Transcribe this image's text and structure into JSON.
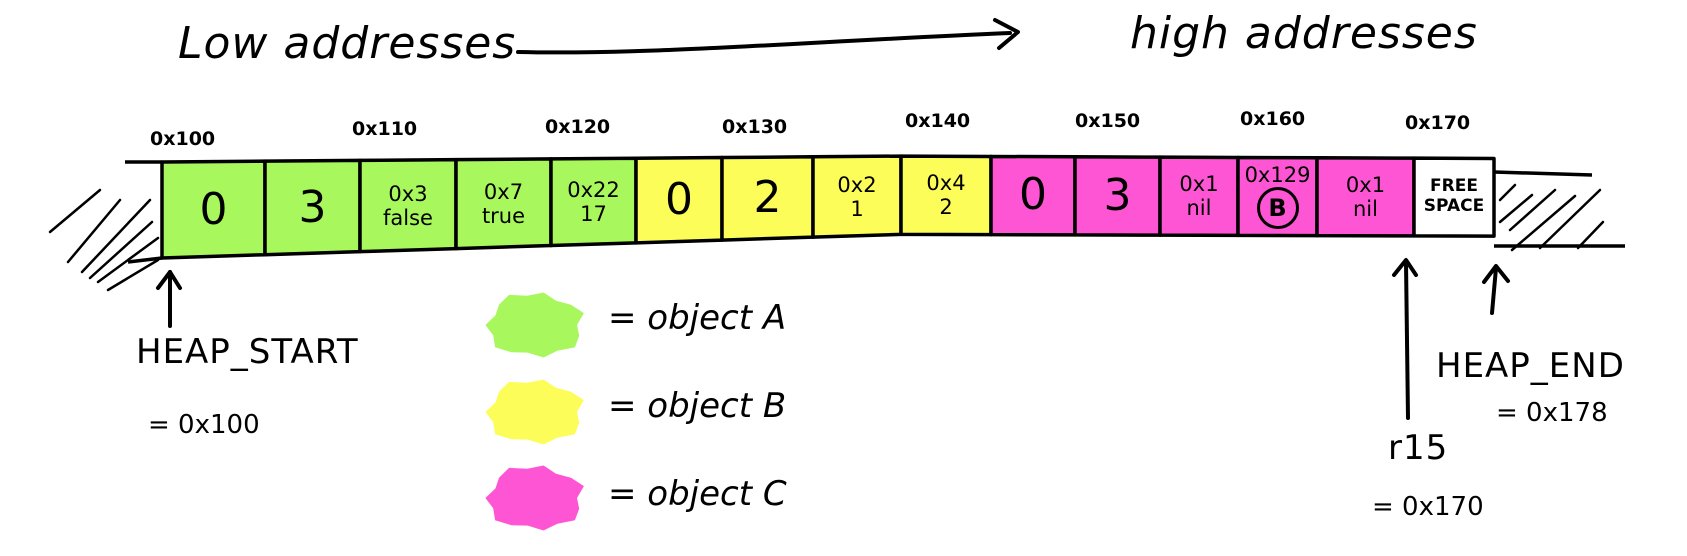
{
  "header": {
    "low_label": "Low addresses",
    "high_label": "high addresses",
    "arrow": "right-arrow-icon"
  },
  "colors": {
    "object_a": "#a8f75c",
    "object_b": "#fdfd5a",
    "object_c": "#fe55d4",
    "free": "#ffffff",
    "ink": "#000000"
  },
  "address_labels": [
    "0x100",
    "0x110",
    "0x120",
    "0x130",
    "0x140",
    "0x150",
    "0x160",
    "0x170"
  ],
  "cells": [
    {
      "object": "A",
      "lines": [
        "0"
      ],
      "size": "big"
    },
    {
      "object": "A",
      "lines": [
        "3"
      ],
      "size": "big"
    },
    {
      "object": "A",
      "lines": [
        "0x3",
        "false"
      ],
      "size": "small"
    },
    {
      "object": "A",
      "lines": [
        "0x7",
        "true"
      ],
      "size": "small"
    },
    {
      "object": "A",
      "lines": [
        "0x22",
        "17"
      ],
      "size": "small"
    },
    {
      "object": "B",
      "lines": [
        "0"
      ],
      "size": "big"
    },
    {
      "object": "B",
      "lines": [
        "2"
      ],
      "size": "big"
    },
    {
      "object": "B",
      "lines": [
        "0x2",
        "1"
      ],
      "size": "small"
    },
    {
      "object": "B",
      "lines": [
        "0x4",
        "2"
      ],
      "size": "small"
    },
    {
      "object": "C",
      "lines": [
        "0"
      ],
      "size": "big"
    },
    {
      "object": "C",
      "lines": [
        "3"
      ],
      "size": "big"
    },
    {
      "object": "C",
      "lines": [
        "0x1",
        "nil"
      ],
      "size": "small"
    },
    {
      "object": "C",
      "lines": [
        "0x129",
        "B"
      ],
      "size": "small",
      "circled_second": true
    },
    {
      "object": "C",
      "lines": [
        "0x1",
        "nil"
      ],
      "size": "small"
    },
    {
      "object": "free",
      "lines": [
        "FREE",
        "SPACE"
      ],
      "size": "tiny"
    }
  ],
  "pointers": {
    "heap_start": {
      "name": "HEAP_START",
      "value": "= 0x100"
    },
    "r15": {
      "name": "r15",
      "value": "= 0x170"
    },
    "heap_end": {
      "name": "HEAP_END",
      "value": "= 0x178"
    }
  },
  "legend": [
    {
      "object": "A",
      "label": "= object A"
    },
    {
      "object": "B",
      "label": "= object B"
    },
    {
      "object": "C",
      "label": "= object C"
    }
  ]
}
